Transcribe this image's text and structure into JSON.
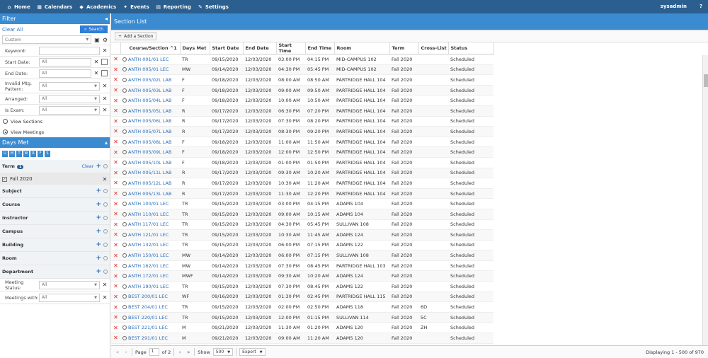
{
  "nav": {
    "home": "Home",
    "calendars": "Calendars",
    "academics": "Academics",
    "events": "Events",
    "reporting": "Reporting",
    "settings": "Settings",
    "user": "sysadmin",
    "help": "?"
  },
  "filter": {
    "title": "Filter",
    "clear_all": "Clear All",
    "search": "Search",
    "saved_placeholder": "Custom",
    "fields": [
      {
        "label": "Keyword:",
        "value": ""
      },
      {
        "label": "Start Date:",
        "value": "All"
      },
      {
        "label": "End Date:",
        "value": "All"
      },
      {
        "label": "Invalid Mtg. Pattern:",
        "value": "All"
      },
      {
        "label": "Arranged:",
        "value": "All"
      },
      {
        "label": "Is Exam:",
        "value": "All"
      }
    ],
    "view_sections": "View Sections",
    "view_meetings": "View Meetings"
  },
  "days_met": {
    "title": "Days Met",
    "days": [
      "U",
      "M",
      "T",
      "W",
      "R",
      "F",
      "S"
    ]
  },
  "term": {
    "label": "Term",
    "count": "1",
    "clear": "Clear",
    "selected": "Fall 2020"
  },
  "sections": [
    "Subject",
    "Course",
    "Instructor",
    "Campus",
    "Building",
    "Room",
    "Department"
  ],
  "meeting_status": {
    "label": "Meeting Status:",
    "value": "All"
  },
  "meetings_with": {
    "label": "Meetings with:",
    "value": "All"
  },
  "main": {
    "title": "Section List",
    "add_section": "Add a Section"
  },
  "columns": [
    "Course/Section ^1",
    "Days Met",
    "Start Date",
    "End Date",
    "Start Time",
    "End Time",
    "Room",
    "Term",
    "Cross-List",
    "Status"
  ],
  "rows": [
    [
      "ANTH 001/01 LEC",
      "TR",
      "09/15/2020",
      "12/03/2020",
      "03:00 PM",
      "04:15 PM",
      "MID-CAMPUS 102",
      "Fall 2020",
      "",
      "Scheduled"
    ],
    [
      "ANTH 005/01 LEC",
      "MW",
      "09/14/2020",
      "12/03/2020",
      "04:30 PM",
      "05:45 PM",
      "MID-CAMPUS 102",
      "Fall 2020",
      "",
      "Scheduled"
    ],
    [
      "ANTH 005/02L LAB",
      "F",
      "09/18/2020",
      "12/03/2020",
      "08:00 AM",
      "08:50 AM",
      "PARTRIDGE HALL 104",
      "Fall 2020",
      "",
      "Scheduled"
    ],
    [
      "ANTH 005/03L LAB",
      "F",
      "09/18/2020",
      "12/03/2020",
      "09:00 AM",
      "09:50 AM",
      "PARTRIDGE HALL 104",
      "Fall 2020",
      "",
      "Scheduled"
    ],
    [
      "ANTH 005/04L LAB",
      "F",
      "09/18/2020",
      "12/03/2020",
      "10:00 AM",
      "10:50 AM",
      "PARTRIDGE HALL 104",
      "Fall 2020",
      "",
      "Scheduled"
    ],
    [
      "ANTH 005/05L LAB",
      "R",
      "09/17/2020",
      "12/03/2020",
      "06:30 PM",
      "07:20 PM",
      "PARTRIDGE HALL 104",
      "Fall 2020",
      "",
      "Scheduled"
    ],
    [
      "ANTH 005/06L LAB",
      "R",
      "09/17/2020",
      "12/03/2020",
      "07:30 PM",
      "08:20 PM",
      "PARTRIDGE HALL 104",
      "Fall 2020",
      "",
      "Scheduled"
    ],
    [
      "ANTH 005/07L LAB",
      "R",
      "09/17/2020",
      "12/03/2020",
      "08:30 PM",
      "09:20 PM",
      "PARTRIDGE HALL 104",
      "Fall 2020",
      "",
      "Scheduled"
    ],
    [
      "ANTH 005/08L LAB",
      "F",
      "09/18/2020",
      "12/03/2020",
      "11:00 AM",
      "11:50 AM",
      "PARTRIDGE HALL 104",
      "Fall 2020",
      "",
      "Scheduled"
    ],
    [
      "ANTH 005/09L LAB",
      "F",
      "09/18/2020",
      "12/03/2020",
      "12:00 PM",
      "12:50 PM",
      "PARTRIDGE HALL 104",
      "Fall 2020",
      "",
      "Scheduled"
    ],
    [
      "ANTH 005/10L LAB",
      "F",
      "09/18/2020",
      "12/03/2020",
      "01:00 PM",
      "01:50 PM",
      "PARTRIDGE HALL 104",
      "Fall 2020",
      "",
      "Scheduled"
    ],
    [
      "ANTH 005/11L LAB",
      "R",
      "09/17/2020",
      "12/03/2020",
      "09:30 AM",
      "10:20 AM",
      "PARTRIDGE HALL 104",
      "Fall 2020",
      "",
      "Scheduled"
    ],
    [
      "ANTH 005/12L LAB",
      "R",
      "09/17/2020",
      "12/03/2020",
      "10:30 AM",
      "11:20 AM",
      "PARTRIDGE HALL 104",
      "Fall 2020",
      "",
      "Scheduled"
    ],
    [
      "ANTH 005/13L LAB",
      "R",
      "09/17/2020",
      "12/03/2020",
      "11:30 AM",
      "12:20 PM",
      "PARTRIDGE HALL 104",
      "Fall 2020",
      "",
      "Scheduled"
    ],
    [
      "ANTH 100/01 LEC",
      "TR",
      "09/15/2020",
      "12/03/2020",
      "03:00 PM",
      "04:15 PM",
      "ADAMS 104",
      "Fall 2020",
      "",
      "Scheduled"
    ],
    [
      "ANTH 110/01 LEC",
      "TR",
      "09/15/2020",
      "12/03/2020",
      "09:00 AM",
      "10:15 AM",
      "ADAMS 104",
      "Fall 2020",
      "",
      "Scheduled"
    ],
    [
      "ANTH 117/01 LEC",
      "TR",
      "09/15/2020",
      "12/03/2020",
      "04:30 PM",
      "05:45 PM",
      "SULLIVAN 108",
      "Fall 2020",
      "",
      "Scheduled"
    ],
    [
      "ANTH 121/01 LEC",
      "TR",
      "09/15/2020",
      "12/03/2020",
      "10:30 AM",
      "11:45 AM",
      "ADAMS 124",
      "Fall 2020",
      "",
      "Scheduled"
    ],
    [
      "ANTH 132/01 LEC",
      "TR",
      "09/15/2020",
      "12/03/2020",
      "06:00 PM",
      "07:15 PM",
      "ADAMS 122",
      "Fall 2020",
      "",
      "Scheduled"
    ],
    [
      "ANTH 150/01 LEC",
      "MW",
      "09/14/2020",
      "12/03/2020",
      "06:00 PM",
      "07:15 PM",
      "SULLIVAN 108",
      "Fall 2020",
      "",
      "Scheduled"
    ],
    [
      "ANTH 162/01 LEC",
      "MW",
      "09/14/2020",
      "12/03/2020",
      "07:30 PM",
      "08:45 PM",
      "PARTRIDGE HALL 103",
      "Fall 2020",
      "",
      "Scheduled"
    ],
    [
      "ANTH 172/01 LEC",
      "MWF",
      "09/14/2020",
      "12/03/2020",
      "09:30 AM",
      "10:20 AM",
      "ADAMS 124",
      "Fall 2020",
      "",
      "Scheduled"
    ],
    [
      "ANTH 190/01 LEC",
      "TR",
      "09/15/2020",
      "12/03/2020",
      "07:30 PM",
      "08:45 PM",
      "ADAMS 122",
      "Fall 2020",
      "",
      "Scheduled"
    ],
    [
      "BEST 200/01 LEC",
      "WF",
      "09/16/2020",
      "12/03/2020",
      "01:30 PM",
      "02:45 PM",
      "PARTRIDGE HALL 115",
      "Fall 2020",
      "",
      "Scheduled"
    ],
    [
      "BEST 204/01 LEC",
      "TR",
      "09/15/2020",
      "12/03/2020",
      "02:00 PM",
      "02:50 PM",
      "ADAMS 118",
      "Fall 2020",
      "6D",
      "Scheduled"
    ],
    [
      "BEST 220/01 LEC",
      "TR",
      "09/15/2020",
      "12/03/2020",
      "12:00 PM",
      "01:15 PM",
      "SULLIVAN 114",
      "Fall 2020",
      "5C",
      "Scheduled"
    ],
    [
      "BEST 221/01 LEC",
      "M",
      "09/21/2020",
      "12/03/2020",
      "11:30 AM",
      "01:20 PM",
      "ADAMS 120",
      "Fall 2020",
      "ZH",
      "Scheduled"
    ],
    [
      "BEST 291/01 LEC",
      "M",
      "09/21/2020",
      "12/03/2020",
      "09:00 AM",
      "11:20 AM",
      "ADAMS 120",
      "Fall 2020",
      "",
      "Scheduled"
    ]
  ],
  "pager": {
    "page_label": "Page",
    "page": "1",
    "of": "of 2",
    "show": "Show",
    "show_value": "500",
    "export": "Export",
    "displaying": "Displaying 1 - 500 of 970"
  }
}
